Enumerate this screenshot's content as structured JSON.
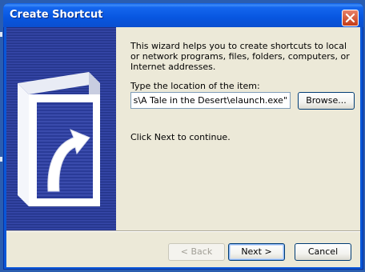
{
  "window": {
    "title": "Create Shortcut"
  },
  "wizard": {
    "intro_text": "This wizard helps you to create shortcuts to local or network programs, files, folders, computers, or Internet addresses.",
    "location_label": "Type the location of the item:",
    "location_value": "\"C:\\Program Files\\eGenesis\\A Tale in the Desert\\elaunch.exe\"",
    "browse_label": "Browse...",
    "continue_text": "Click Next to continue."
  },
  "buttons": {
    "back_label": "< Back",
    "back_enabled": false,
    "next_label": "Next >",
    "cancel_label": "Cancel"
  },
  "colors": {
    "title_bar": "#0a57d8",
    "panel_dark": "#1c2d7e",
    "panel_light": "#3e4fb5",
    "dialog_bg": "#ece9d8"
  },
  "icons": {
    "close": "close-icon",
    "shortcut": "shortcut-arrow-icon"
  }
}
